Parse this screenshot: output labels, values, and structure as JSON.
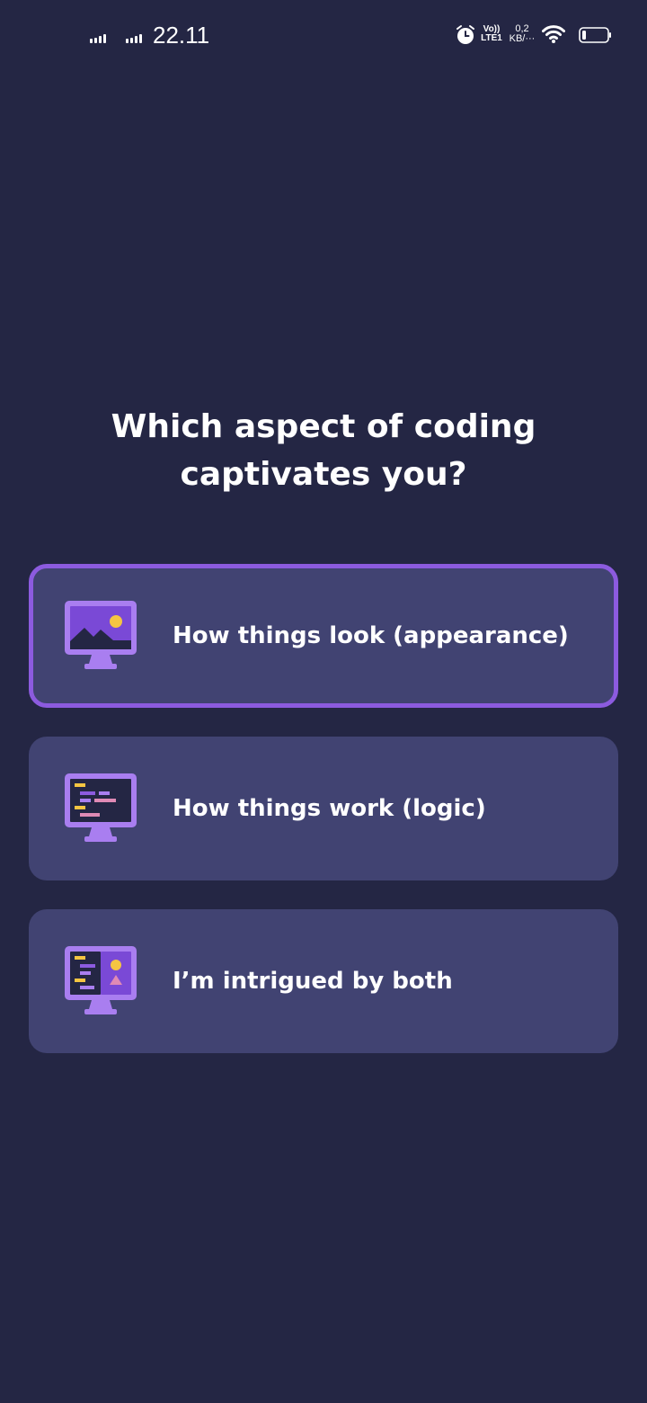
{
  "status_bar": {
    "time": "22.11",
    "volte_line1": "Vo))",
    "volte_line2": "LTE1",
    "speed_value": "0,2",
    "speed_unit": "KB/···"
  },
  "question": "Which aspect of coding captivates you?",
  "options": [
    {
      "label": "How things look (appearance)",
      "icon": "monitor-image-icon",
      "selected": true
    },
    {
      "label": "How things work (logic)",
      "icon": "monitor-code-icon",
      "selected": false
    },
    {
      "label": "I’m intrigued by both",
      "icon": "monitor-code-and-image-icon",
      "selected": false
    }
  ],
  "colors": {
    "background": "#242644",
    "card": "#414372",
    "selected_border": "#8c5bdf",
    "icon_purple": "#a97ef0",
    "accent_yellow": "#f5c542",
    "accent_pink": "#e08ab5"
  }
}
